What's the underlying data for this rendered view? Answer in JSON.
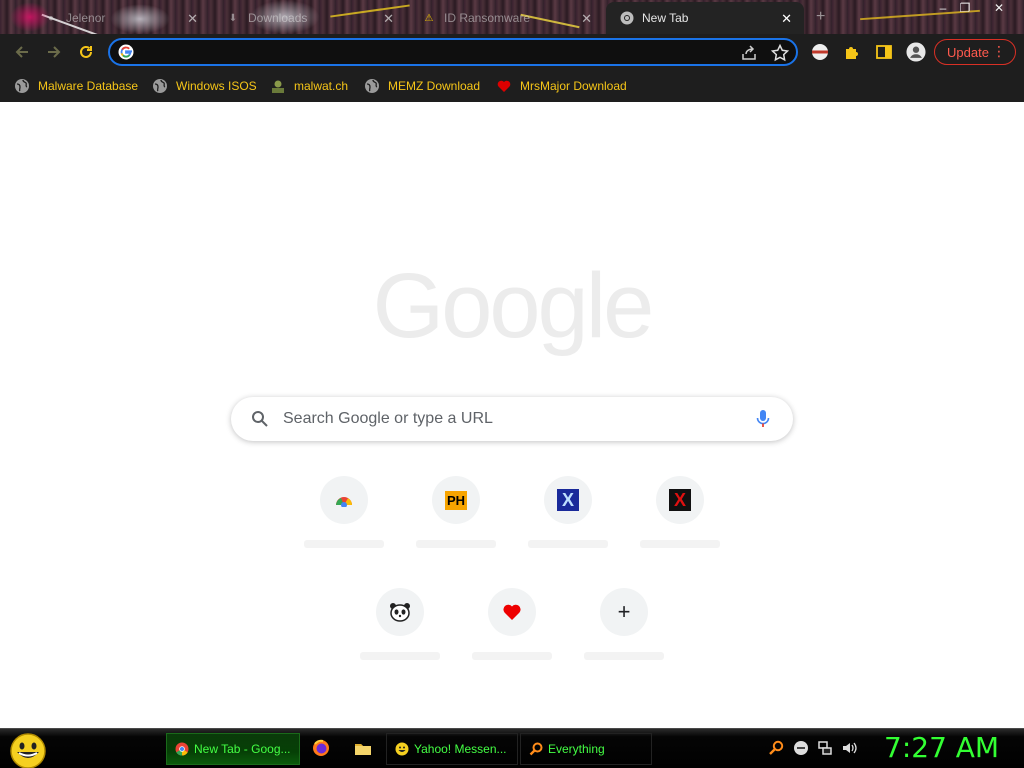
{
  "browser": {
    "tabs": [
      {
        "title": "Jelenor",
        "active": false
      },
      {
        "title": "Downloads",
        "active": false
      },
      {
        "title": "ID Ransomware",
        "active": false
      },
      {
        "title": "New Tab",
        "active": true
      }
    ],
    "window_controls": {
      "minimize": "–",
      "restore": "❐",
      "close": "✕"
    },
    "address_bar": {
      "value": "",
      "placeholder": ""
    },
    "update_label": "Update",
    "bookmarks": [
      {
        "label": "Malware Database",
        "icon": "globe-icon"
      },
      {
        "label": "Windows ISOS",
        "icon": "globe-icon"
      },
      {
        "label": "malwat.ch",
        "icon": "malwatch-icon"
      },
      {
        "label": "MEMZ Download",
        "icon": "globe-icon"
      },
      {
        "label": "MrsMajor Download",
        "icon": "heart-icon"
      }
    ]
  },
  "ntp": {
    "logo_text": "Google",
    "search_placeholder": "Search Google or type a URL",
    "shortcuts": [
      {
        "icon": "chrome-web-store-icon",
        "badge": ""
      },
      {
        "icon": "ph-icon",
        "badge": "PH"
      },
      {
        "icon": "blue-x-icon",
        "badge": "X"
      },
      {
        "icon": "red-x-icon",
        "badge": "X"
      },
      {
        "icon": "panda-icon",
        "badge": ""
      },
      {
        "icon": "heart-icon",
        "badge": ""
      },
      {
        "icon": "add-shortcut-icon",
        "badge": "+"
      }
    ]
  },
  "taskbar": {
    "items": [
      {
        "label": "New Tab - Goog...",
        "icon": "chrome-icon",
        "active": true
      },
      {
        "label": "Yahoo! Messen...",
        "icon": "smiley-icon",
        "active": false
      },
      {
        "label": "Everything",
        "icon": "magnifier-icon",
        "active": false
      }
    ],
    "clock": "7:27 AM"
  },
  "colors": {
    "accent": "#1a73e8",
    "bookmark_text": "#f5c518",
    "update_red": "#d93025",
    "taskbar_green": "#33ff33"
  }
}
